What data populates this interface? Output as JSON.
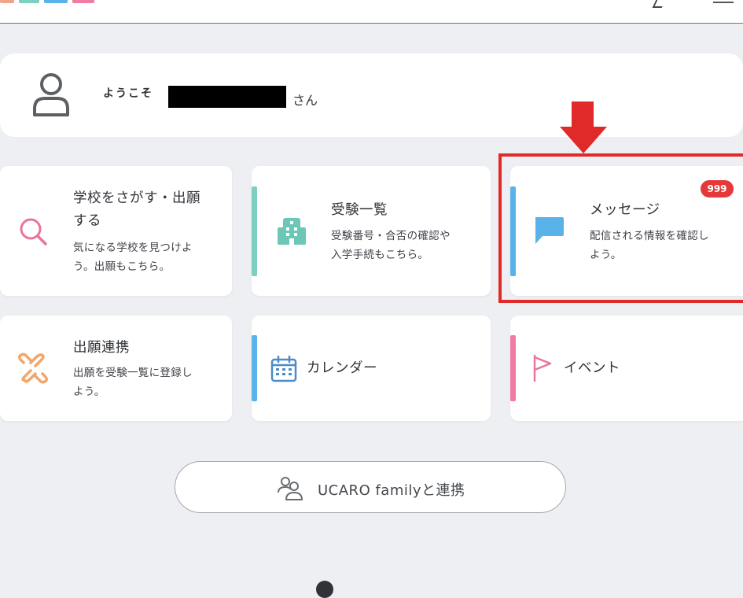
{
  "header": {
    "logo_colors": [
      "#f3a38a",
      "#7dcfbf",
      "#5ab3e8",
      "#f07ba3"
    ]
  },
  "welcome": {
    "greeting": "ようこそ",
    "suffix": "さん"
  },
  "cards": {
    "search": {
      "title_line1": "学校をさがす・出願",
      "title_line2": "する",
      "desc_line1": "気になる学校を見つけよ",
      "desc_line2": "う。出願もこちら。",
      "icon": "search-icon",
      "icon_color": "#e9759a"
    },
    "exams": {
      "title": "受験一覧",
      "desc_line1": "受験番号・合否の確認や",
      "desc_line2": "入学手続もこちら。",
      "icon": "school-building-icon",
      "accent": "#7dcfbf"
    },
    "messages": {
      "title": "メッセージ",
      "desc_line1": "配信される情報を確認し",
      "desc_line2": "よう。",
      "badge": "999",
      "icon": "chat-bubble-icon",
      "accent": "#5ab3e8"
    },
    "link": {
      "title": "出願連携",
      "desc_line1": "出願を受験一覧に登録し",
      "desc_line2": "よう。",
      "icon": "link-icon",
      "icon_color": "#f2a66b"
    },
    "calendar": {
      "title": "カレンダー",
      "icon": "calendar-icon",
      "accent": "#5ab3e8"
    },
    "event": {
      "title": "イベント",
      "icon": "flag-icon",
      "accent": "#f07ba3"
    }
  },
  "family_button": {
    "label": "UCARO familyと連携",
    "icon": "people-icon"
  },
  "annotation": {
    "color": "#e02a2a"
  }
}
